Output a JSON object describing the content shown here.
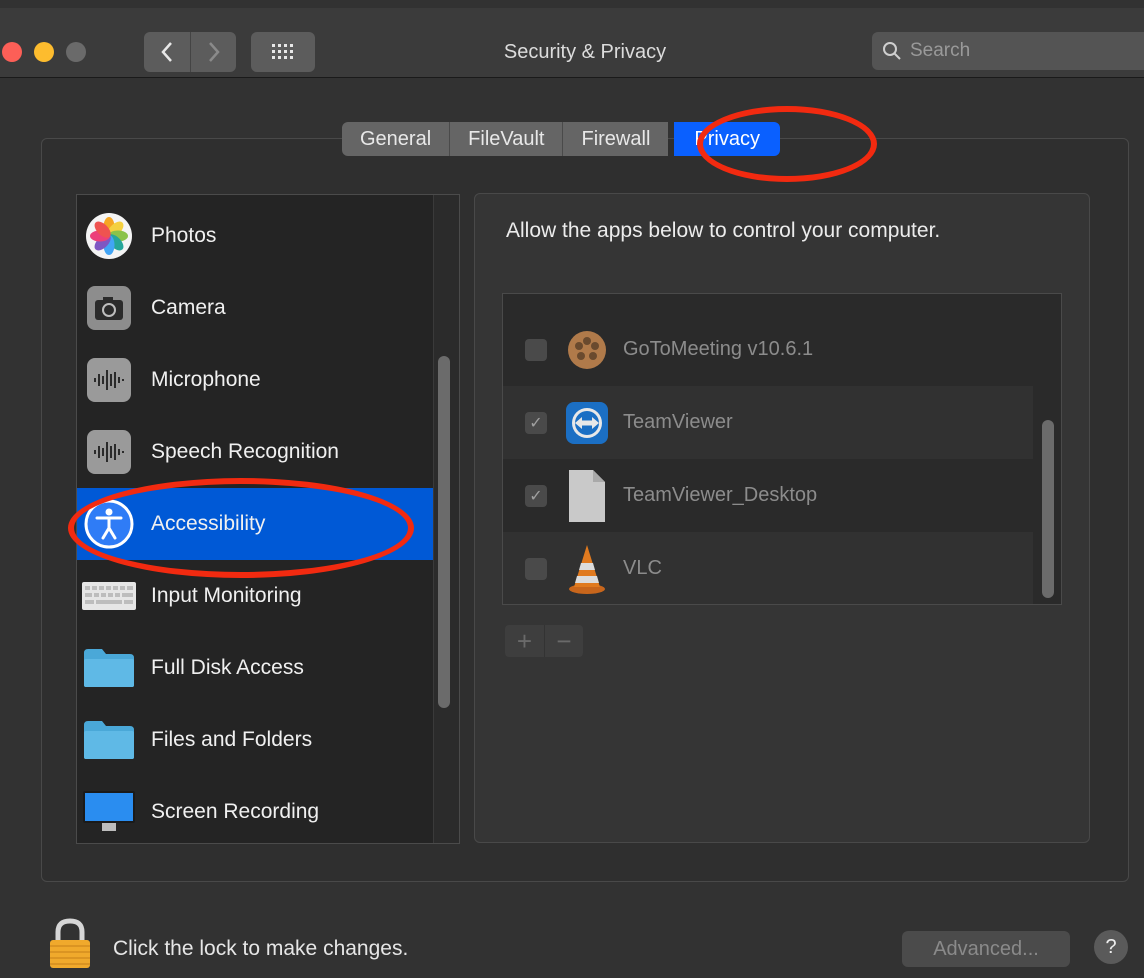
{
  "window": {
    "title": "Security & Privacy"
  },
  "search": {
    "placeholder": "Search"
  },
  "tabs": [
    {
      "label": "General"
    },
    {
      "label": "FileVault"
    },
    {
      "label": "Firewall"
    },
    {
      "label": "Privacy",
      "active": true
    }
  ],
  "sidebar": {
    "items": [
      {
        "label": "Photos",
        "icon": "photos-icon"
      },
      {
        "label": "Camera",
        "icon": "camera-icon"
      },
      {
        "label": "Microphone",
        "icon": "microphone-icon"
      },
      {
        "label": "Speech Recognition",
        "icon": "speech-recognition-icon"
      },
      {
        "label": "Accessibility",
        "icon": "accessibility-icon",
        "selected": true
      },
      {
        "label": "Input Monitoring",
        "icon": "keyboard-icon"
      },
      {
        "label": "Full Disk Access",
        "icon": "folder-icon"
      },
      {
        "label": "Files and Folders",
        "icon": "folder-icon"
      },
      {
        "label": "Screen Recording",
        "icon": "display-icon"
      }
    ]
  },
  "main": {
    "description": "Allow the apps below to control your computer.",
    "apps": [
      {
        "label": "GoToMeeting v10.6.1",
        "checked": false,
        "icon": "gotomeeting-icon"
      },
      {
        "label": "TeamViewer",
        "checked": true,
        "icon": "teamviewer-icon"
      },
      {
        "label": "TeamViewer_Desktop",
        "checked": true,
        "icon": "document-icon"
      },
      {
        "label": "VLC",
        "checked": false,
        "icon": "vlc-cone-icon"
      }
    ],
    "add_label": "+",
    "remove_label": "−"
  },
  "footer": {
    "lock_text": "Click the lock to make changes.",
    "advanced_label": "Advanced...",
    "help_label": "?"
  },
  "colors": {
    "accent": "#0a60ff",
    "selection": "#0059d6",
    "annotation": "#f22a10"
  }
}
